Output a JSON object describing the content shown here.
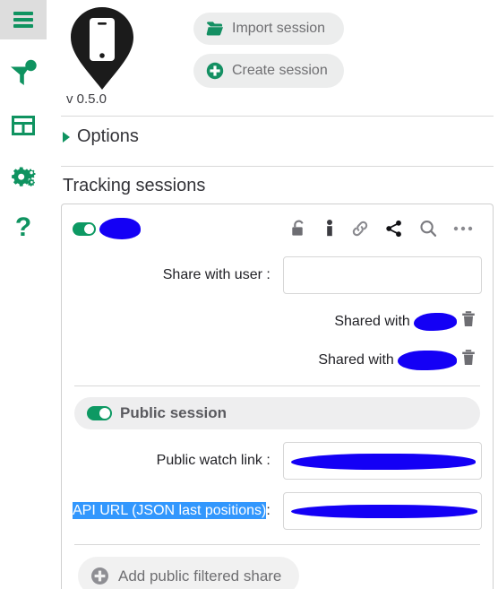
{
  "sidebar": {
    "items": [
      {
        "name": "menu-toggle",
        "icon": "hamburger-icon",
        "label": ""
      },
      {
        "name": "filter",
        "icon": "funnel-icon",
        "label": ""
      },
      {
        "name": "table",
        "icon": "table-grid-icon",
        "label": ""
      },
      {
        "name": "settings",
        "icon": "gears-icon",
        "label": ""
      },
      {
        "name": "help",
        "icon": "question-mark-icon",
        "label": "?"
      }
    ]
  },
  "header": {
    "logo_icon": "map-pin-phone-logo",
    "version": "v 0.5.0",
    "buttons": [
      {
        "label": "Import session",
        "icon": "folder-open-icon"
      },
      {
        "label": "Create session",
        "icon": "plus-circle-icon"
      }
    ]
  },
  "options": {
    "label": "Options",
    "expanded": false,
    "marker_icon": "triangle-right-icon"
  },
  "tracking": {
    "section_title": "Tracking sessions"
  },
  "session": {
    "enabled_toggle": true,
    "name_redacted": true,
    "actions": [
      {
        "name": "unlock-icon",
        "title": ""
      },
      {
        "name": "person-icon",
        "title": ""
      },
      {
        "name": "link-icon",
        "title": ""
      },
      {
        "name": "share-icon",
        "title": ""
      },
      {
        "name": "search-icon",
        "title": ""
      },
      {
        "name": "more-options-icon",
        "title": ""
      }
    ],
    "share_with_user": {
      "label": "Share with user :",
      "value": "",
      "placeholder": ""
    },
    "shared_entries": [
      {
        "label": "Shared with",
        "user_redacted": true,
        "delete_icon": "trash-icon"
      },
      {
        "label": "Shared with",
        "user_redacted": true,
        "delete_icon": "trash-icon"
      }
    ],
    "public_session": {
      "label": "Public session",
      "enabled": true
    },
    "public_watch_link": {
      "label": "Public watch link :",
      "value_redacted": true
    },
    "api_url": {
      "label": "API URL (JSON last positions)",
      "label_selected": true,
      "separator": ":",
      "value_redacted": true
    },
    "add_public_filtered_share": {
      "label": "Add public filtered share",
      "icon": "plus-circle-icon"
    }
  },
  "colors": {
    "accent_green": "#0f9360",
    "toggle_green": "#0d9963",
    "redaction_blue": "#1400f5",
    "selection_blue": "#3297fd",
    "button_gray": "#eceded",
    "text_dark": "#333338"
  }
}
